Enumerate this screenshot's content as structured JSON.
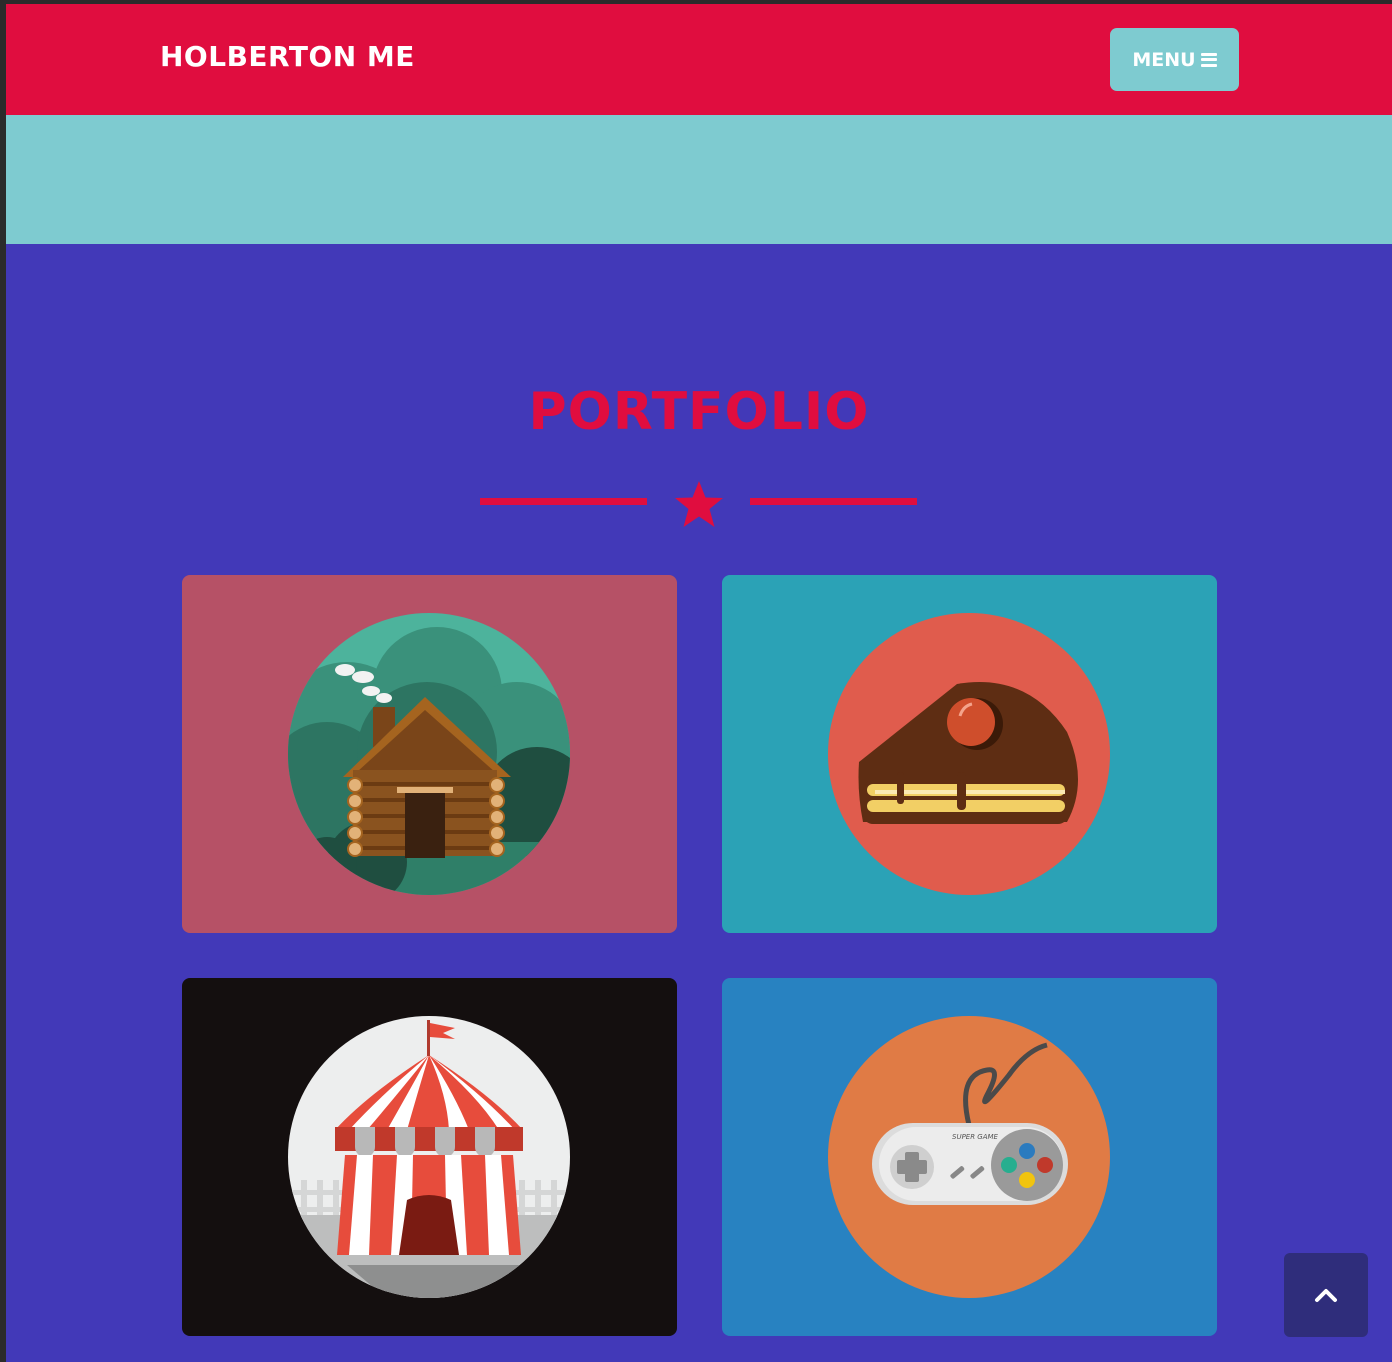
{
  "nav": {
    "brand": "HOLBERTON ME",
    "menu_label": "MENU"
  },
  "portfolio": {
    "title": "PORTFOLIO",
    "items": [
      {
        "name": "cabin",
        "bg": "#b65166",
        "circle": "#2f7f68"
      },
      {
        "name": "cake",
        "bg": "#2ba2b6",
        "circle": "#e05c4d"
      },
      {
        "name": "circus",
        "bg": "#140f0f",
        "circle": "#edeeee"
      },
      {
        "name": "game",
        "bg": "#2882c1",
        "circle": "#e07b45"
      }
    ]
  },
  "colors": {
    "navbar": "#e00d3f",
    "hero": "#7ecbd0",
    "page_bg": "#4239b8",
    "accent": "#e00d3f",
    "scroll_button": "#2f2d7b"
  },
  "icons": {
    "menu": "bars-icon",
    "divider": "star-icon",
    "scroll": "chevron-up-icon"
  }
}
